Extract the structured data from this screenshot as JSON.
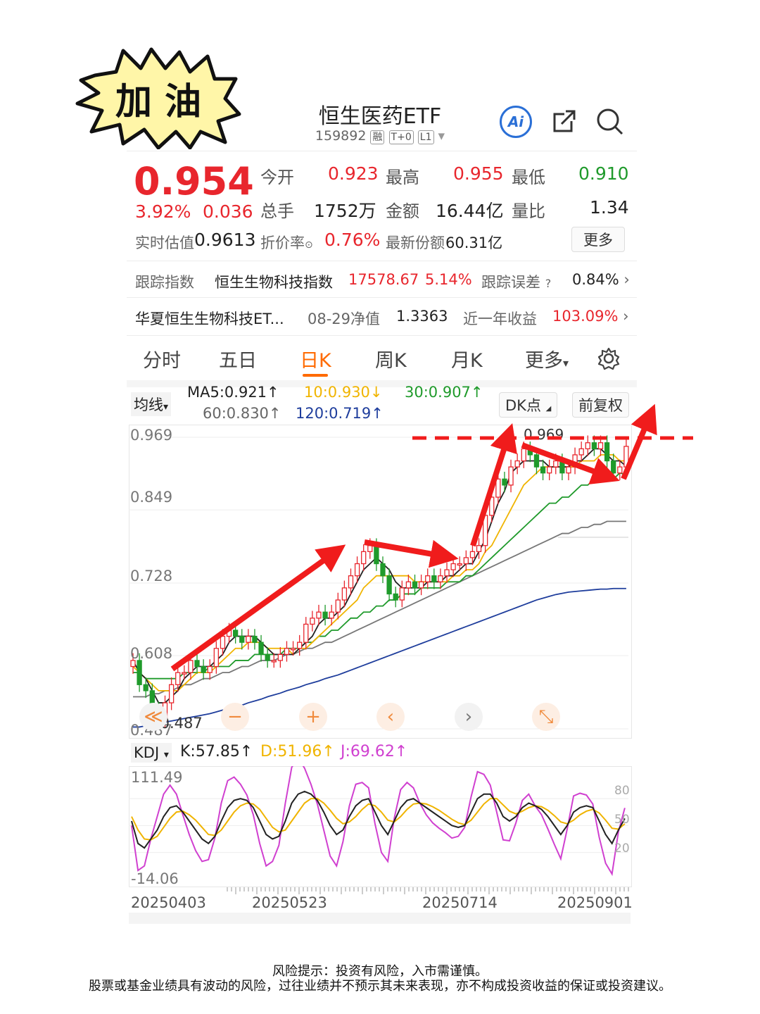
{
  "sticker": {
    "text": "加 油",
    "fill": "#fff6a8"
  },
  "header": {
    "title": "恒生医药ETF",
    "code": "159892",
    "tags": [
      "融",
      "T+0",
      "L1"
    ],
    "ai_label": "Ai"
  },
  "quote": {
    "price": "0.954",
    "change_pct": "3.92%",
    "change": "0.036",
    "open_label": "今开",
    "open": "0.923",
    "high_label": "最高",
    "high": "0.955",
    "low_label": "最低",
    "low": "0.910",
    "volume_label": "总手",
    "volume": "1752万",
    "amount_label": "金额",
    "amount": "16.44亿",
    "ratio_label": "量比",
    "ratio": "1.34",
    "iopv_label": "实时估值",
    "iopv": "0.9613",
    "discount_label": "折价率",
    "discount": "0.76%",
    "shares_label": "最新份额",
    "shares": "60.31亿",
    "more_button": "更多"
  },
  "tracking": {
    "label": "跟踪指数",
    "index_name": "恒生生物科技指数",
    "index_value": "17578.67",
    "index_pct": "5.14%",
    "error_label": "跟踪误差",
    "error_value": "0.84%"
  },
  "related": {
    "fund_name": "华夏恒生生物科技ET...",
    "nav_label": "08-29净值",
    "nav": "1.3363",
    "return_label": "近一年收益",
    "return_value": "103.09%"
  },
  "tabs": [
    "分时",
    "五日",
    "日K",
    "周K",
    "月K",
    "更多"
  ],
  "active_tab": 2,
  "ma_bar": {
    "selector": "均线",
    "ma5": "MA5:0.921↑",
    "ma10": "10:0.930↓",
    "ma30": "30:0.907↑",
    "ma60": "60:0.830↑",
    "ma120": "120:0.719↑",
    "dk_button": "DK点",
    "adjust_button": "前复权"
  },
  "kdj_bar": {
    "selector": "KDJ",
    "k": "K:57.85↑",
    "d": "D:51.96↑",
    "j": "J:69.62↑"
  },
  "colors": {
    "up": "#e8262d",
    "down": "#1f9a2b",
    "ma5": "#222222",
    "ma10": "#f0b400",
    "ma30": "#1f9a2b",
    "ma60": "#777777",
    "ma120": "#1e3d9c",
    "k": "#222222",
    "d": "#f0b400",
    "j": "#d040d0"
  },
  "chart_data": {
    "type": "candlestick",
    "y_ticks": [
      "0.969",
      "0.849",
      "0.728",
      "0.608",
      "0.487"
    ],
    "ylim": [
      0.487,
      0.969
    ],
    "max_label": "0.969",
    "min_label": "0.487",
    "x_labels": [
      "20250403",
      "20250523",
      "20250714",
      "20250901"
    ],
    "close": [
      0.6,
      0.56,
      0.55,
      0.52,
      0.5,
      0.53,
      0.56,
      0.58,
      0.58,
      0.6,
      0.59,
      0.58,
      0.59,
      0.62,
      0.64,
      0.65,
      0.64,
      0.63,
      0.64,
      0.63,
      0.61,
      0.6,
      0.6,
      0.61,
      0.62,
      0.62,
      0.63,
      0.66,
      0.67,
      0.68,
      0.67,
      0.68,
      0.7,
      0.72,
      0.74,
      0.76,
      0.78,
      0.79,
      0.76,
      0.74,
      0.71,
      0.7,
      0.72,
      0.73,
      0.72,
      0.73,
      0.74,
      0.73,
      0.74,
      0.75,
      0.76,
      0.76,
      0.77,
      0.78,
      0.79,
      0.84,
      0.87,
      0.9,
      0.89,
      0.92,
      0.93,
      0.95,
      0.94,
      0.92,
      0.91,
      0.92,
      0.93,
      0.91,
      0.92,
      0.94,
      0.95,
      0.96,
      0.95,
      0.96,
      0.93,
      0.91,
      0.92,
      0.954
    ],
    "ma5": [
      0.6,
      0.58,
      0.57,
      0.55,
      0.53,
      0.53,
      0.54,
      0.55,
      0.57,
      0.58,
      0.59,
      0.59,
      0.59,
      0.6,
      0.61,
      0.63,
      0.64,
      0.64,
      0.64,
      0.64,
      0.63,
      0.62,
      0.61,
      0.61,
      0.61,
      0.61,
      0.62,
      0.63,
      0.64,
      0.66,
      0.67,
      0.67,
      0.68,
      0.69,
      0.71,
      0.73,
      0.75,
      0.76,
      0.77,
      0.76,
      0.75,
      0.73,
      0.72,
      0.72,
      0.72,
      0.72,
      0.73,
      0.73,
      0.73,
      0.74,
      0.74,
      0.75,
      0.76,
      0.76,
      0.78,
      0.8,
      0.83,
      0.86,
      0.88,
      0.91,
      0.92,
      0.93,
      0.93,
      0.93,
      0.93,
      0.92,
      0.92,
      0.92,
      0.92,
      0.93,
      0.93,
      0.94,
      0.95,
      0.95,
      0.94,
      0.93,
      0.93,
      0.921
    ],
    "ma10": [
      0.59,
      0.58,
      0.57,
      0.56,
      0.55,
      0.55,
      0.55,
      0.55,
      0.56,
      0.57,
      0.58,
      0.58,
      0.58,
      0.59,
      0.6,
      0.61,
      0.62,
      0.62,
      0.63,
      0.63,
      0.63,
      0.62,
      0.62,
      0.62,
      0.62,
      0.61,
      0.62,
      0.62,
      0.63,
      0.64,
      0.65,
      0.66,
      0.67,
      0.68,
      0.69,
      0.7,
      0.72,
      0.73,
      0.74,
      0.74,
      0.74,
      0.74,
      0.74,
      0.74,
      0.73,
      0.73,
      0.73,
      0.73,
      0.73,
      0.73,
      0.74,
      0.74,
      0.75,
      0.75,
      0.76,
      0.78,
      0.79,
      0.81,
      0.83,
      0.85,
      0.87,
      0.89,
      0.9,
      0.91,
      0.92,
      0.92,
      0.92,
      0.92,
      0.92,
      0.92,
      0.93,
      0.93,
      0.93,
      0.94,
      0.94,
      0.94,
      0.93,
      0.93
    ],
    "ma30": [
      0.58,
      0.58,
      0.57,
      0.57,
      0.57,
      0.57,
      0.57,
      0.57,
      0.58,
      0.58,
      0.58,
      0.58,
      0.59,
      0.59,
      0.59,
      0.59,
      0.6,
      0.6,
      0.6,
      0.61,
      0.61,
      0.61,
      0.61,
      0.61,
      0.62,
      0.62,
      0.62,
      0.63,
      0.63,
      0.64,
      0.64,
      0.65,
      0.65,
      0.66,
      0.67,
      0.67,
      0.68,
      0.68,
      0.69,
      0.69,
      0.7,
      0.7,
      0.71,
      0.71,
      0.71,
      0.72,
      0.72,
      0.72,
      0.72,
      0.73,
      0.73,
      0.73,
      0.74,
      0.74,
      0.75,
      0.76,
      0.77,
      0.78,
      0.79,
      0.8,
      0.81,
      0.82,
      0.83,
      0.84,
      0.85,
      0.86,
      0.86,
      0.87,
      0.87,
      0.88,
      0.89,
      0.89,
      0.9,
      0.9,
      0.9,
      0.9,
      0.91,
      0.907
    ],
    "ma60": [
      0.54,
      0.54,
      0.54,
      0.545,
      0.545,
      0.55,
      0.55,
      0.555,
      0.56,
      0.56,
      0.565,
      0.57,
      0.57,
      0.575,
      0.58,
      0.58,
      0.585,
      0.59,
      0.59,
      0.595,
      0.6,
      0.6,
      0.6,
      0.605,
      0.61,
      0.61,
      0.615,
      0.62,
      0.62,
      0.625,
      0.63,
      0.63,
      0.635,
      0.64,
      0.645,
      0.65,
      0.655,
      0.66,
      0.665,
      0.67,
      0.675,
      0.68,
      0.685,
      0.69,
      0.695,
      0.7,
      0.705,
      0.71,
      0.715,
      0.72,
      0.725,
      0.73,
      0.735,
      0.74,
      0.745,
      0.75,
      0.755,
      0.76,
      0.765,
      0.77,
      0.775,
      0.78,
      0.785,
      0.79,
      0.795,
      0.8,
      0.805,
      0.81,
      0.81,
      0.815,
      0.82,
      0.82,
      0.825,
      0.825,
      0.83,
      0.83,
      0.83,
      0.83
    ],
    "ma120": [
      0.49,
      0.49,
      0.492,
      0.494,
      0.496,
      0.498,
      0.5,
      0.502,
      0.504,
      0.506,
      0.508,
      0.51,
      0.512,
      0.515,
      0.518,
      0.52,
      0.523,
      0.526,
      0.53,
      0.533,
      0.536,
      0.54,
      0.543,
      0.546,
      0.55,
      0.553,
      0.556,
      0.56,
      0.563,
      0.566,
      0.57,
      0.573,
      0.576,
      0.58,
      0.584,
      0.588,
      0.592,
      0.596,
      0.6,
      0.604,
      0.608,
      0.612,
      0.616,
      0.62,
      0.624,
      0.628,
      0.632,
      0.636,
      0.64,
      0.644,
      0.648,
      0.652,
      0.656,
      0.66,
      0.664,
      0.668,
      0.672,
      0.676,
      0.68,
      0.684,
      0.688,
      0.692,
      0.696,
      0.7,
      0.703,
      0.706,
      0.709,
      0.711,
      0.713,
      0.714,
      0.715,
      0.716,
      0.717,
      0.718,
      0.718,
      0.719,
      0.719,
      0.719
    ],
    "kdj": {
      "ylim": [
        -14.06,
        111.49
      ],
      "y_top_label": "111.49",
      "y_bottom_label": "-14.06",
      "right_ticks": [
        "80",
        "50",
        "20"
      ],
      "k": [
        55,
        30,
        25,
        35,
        45,
        60,
        70,
        72,
        65,
        55,
        45,
        35,
        30,
        38,
        55,
        70,
        78,
        80,
        78,
        70,
        55,
        40,
        35,
        38,
        55,
        75,
        85,
        88,
        85,
        78,
        65,
        50,
        40,
        45,
        60,
        72,
        78,
        80,
        65,
        50,
        40,
        55,
        70,
        78,
        80,
        75,
        70,
        65,
        60,
        55,
        50,
        48,
        50,
        65,
        80,
        85,
        85,
        75,
        60,
        55,
        60,
        70,
        75,
        72,
        68,
        60,
        50,
        40,
        50,
        65,
        70,
        72,
        70,
        55,
        40,
        30,
        45,
        57.85
      ],
      "d": [
        60,
        45,
        35,
        34,
        38,
        48,
        58,
        65,
        66,
        62,
        56,
        48,
        40,
        39,
        45,
        55,
        65,
        72,
        75,
        74,
        68,
        58,
        48,
        43,
        45,
        55,
        65,
        75,
        80,
        80,
        75,
        67,
        58,
        52,
        54,
        60,
        68,
        74,
        72,
        65,
        56,
        54,
        60,
        68,
        74,
        75,
        74,
        71,
        67,
        62,
        57,
        53,
        51,
        56,
        65,
        74,
        80,
        80,
        73,
        66,
        63,
        66,
        70,
        72,
        71,
        67,
        61,
        54,
        52,
        56,
        62,
        66,
        68,
        64,
        56,
        47,
        46,
        51.96
      ],
      "j": [
        50,
        0,
        5,
        35,
        60,
        85,
        95,
        85,
        62,
        40,
        22,
        10,
        12,
        36,
        75,
        100,
        104,
        96,
        84,
        62,
        30,
        5,
        10,
        28,
        75,
        115,
        125,
        114,
        96,
        74,
        45,
        16,
        5,
        32,
        72,
        96,
        98,
        92,
        52,
        20,
        10,
        58,
        90,
        98,
        92,
        75,
        62,
        53,
        47,
        42,
        36,
        38,
        48,
        82,
        110,
        107,
        95,
        65,
        34,
        33,
        53,
        78,
        85,
        72,
        62,
        46,
        29,
        13,
        46,
        83,
        86,
        84,
        74,
        37,
        8,
        -4,
        43,
        69.62
      ]
    }
  },
  "zoom_controls": [
    "≪",
    "−",
    "+",
    "‹",
    "›",
    "⤡"
  ],
  "footer": {
    "line1": "风险提示：投资有风险，入市需谨慎。",
    "line2": "股票或基金业绩具有波动的风险，过往业绩并不预示其未来表现，亦不构成投资收益的保证或投资建议。"
  }
}
